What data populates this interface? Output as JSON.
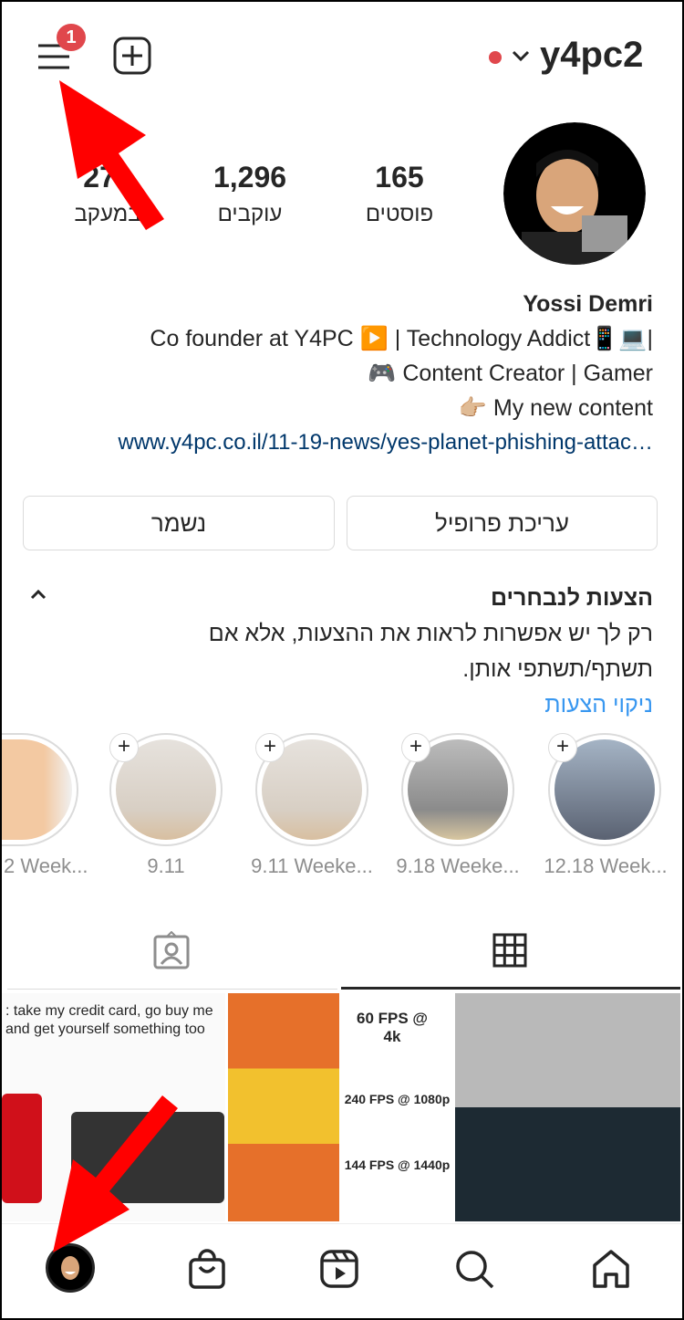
{
  "header": {
    "username": "y4pc2",
    "notification_count": "1",
    "status_dot_color": "#e0474c"
  },
  "stats": [
    {
      "value": "165",
      "label": "פוסטים"
    },
    {
      "value": "1,296",
      "label": "עוקבים"
    },
    {
      "value": "270",
      "label": "במעקב"
    }
  ],
  "profile": {
    "name": "Yossi Demri",
    "bio": [
      "Co founder at Y4PC ▶️ | Technology Addict📱💻|",
      "🎮 Content Creator  | Gamer",
      "👉🏼 My new content"
    ],
    "link": "www.y4pc.co.il/11-19-news/yes-planet-phishing-attac…"
  },
  "buttons": {
    "edit_profile": "עריכת פרופיל",
    "saved": "נשמר"
  },
  "suggestions": {
    "title": "הצעות לנבחרים",
    "text": "רק לך יש אפשרות לראות את ההצעות, אלא אם תשתף/תשתפי אותן.",
    "clear": "ניקוי הצעות"
  },
  "highlights": [
    {
      "label": "12.18 Week..."
    },
    {
      "label": "9.18 Weeke..."
    },
    {
      "label": "9.11 Weeke..."
    },
    {
      "label": "9.11"
    },
    {
      "label": "2 Week..."
    }
  ],
  "grid": {
    "post1_text": ": take my credit card, go buy me and get yourself something too",
    "fps": [
      "60 FPS @ 4k",
      "240 FPS @ 1080p",
      "144 FPS @ 1440p"
    ]
  },
  "tabs": {
    "active": "grid"
  },
  "colors": {
    "link": "#00376b",
    "accent_link": "#0095f6",
    "annotation_arrow": "#ff0000"
  }
}
